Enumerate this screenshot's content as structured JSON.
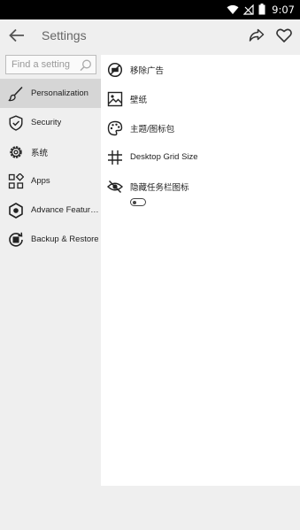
{
  "status_bar": {
    "time": "9:07",
    "icons": [
      "wifi-icon",
      "signal-off-icon",
      "battery-icon"
    ]
  },
  "header": {
    "title": "Settings",
    "back_icon": "arrow-left-icon",
    "share_icon": "share-icon",
    "favorite_icon": "heart-icon"
  },
  "search": {
    "placeholder": "Find a setting",
    "value": ""
  },
  "sidebar": {
    "items": [
      {
        "label": "Personalization",
        "icon": "brush-icon",
        "active": true
      },
      {
        "label": "Security",
        "icon": "shield-icon",
        "active": false
      },
      {
        "label": "系统",
        "icon": "gear-icon",
        "active": false
      },
      {
        "label": "Apps",
        "icon": "apps-grid-icon",
        "active": false
      },
      {
        "label": "Advance Featur…",
        "icon": "hexagon-icon",
        "active": false
      },
      {
        "label": "Backup & Restore",
        "icon": "backup-icon",
        "active": false
      }
    ]
  },
  "content": {
    "rows": [
      {
        "label": "移除广告",
        "icon": "no-ads-icon"
      },
      {
        "label": "壁纸",
        "icon": "image-icon"
      },
      {
        "label": "主题/图标包",
        "icon": "palette-icon"
      },
      {
        "label": "Desktop Grid Size",
        "icon": "grid-icon"
      },
      {
        "label": "隐藏任务栏图标",
        "icon": "eye-off-icon"
      }
    ],
    "toggle": {
      "state": "off"
    }
  },
  "colors": {
    "status_bar": "#000000",
    "background": "#efefef",
    "panel": "#ffffff",
    "active_item": "#d6d6d6",
    "icon": "#222222"
  }
}
